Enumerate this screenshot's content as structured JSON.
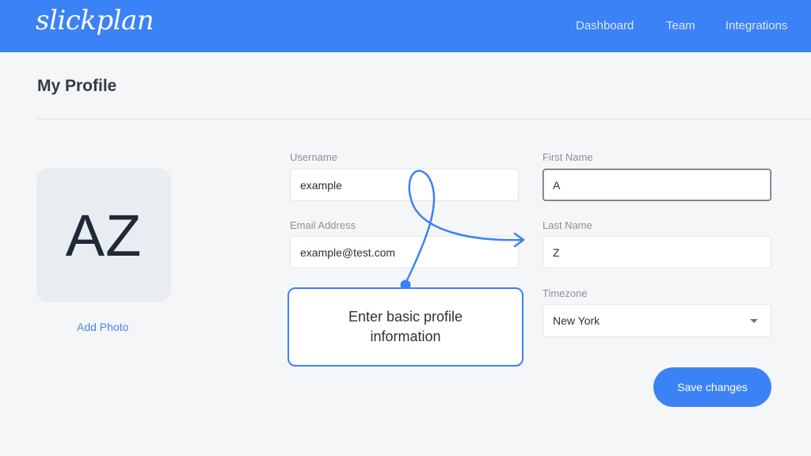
{
  "app": {
    "logo_text": "slickplan"
  },
  "nav": {
    "items": [
      {
        "label": "Dashboard"
      },
      {
        "label": "Team"
      },
      {
        "label": "Integrations"
      }
    ]
  },
  "page": {
    "title": "My Profile"
  },
  "avatar": {
    "initials": "AZ",
    "add_photo_label": "Add Photo"
  },
  "form": {
    "username": {
      "label": "Username",
      "value": "example"
    },
    "email": {
      "label": "Email Address",
      "value": "example@test.com"
    },
    "first_name": {
      "label": "First Name",
      "value": "A"
    },
    "last_name": {
      "label": "Last Name",
      "value": "Z"
    },
    "timezone": {
      "label": "Timezone",
      "value": "New York"
    },
    "save_label": "Save changes"
  },
  "callout": {
    "text": "Enter basic profile information"
  },
  "colors": {
    "brand": "#3b82f6",
    "background": "#f5f6f8",
    "link": "#4a86e8"
  }
}
